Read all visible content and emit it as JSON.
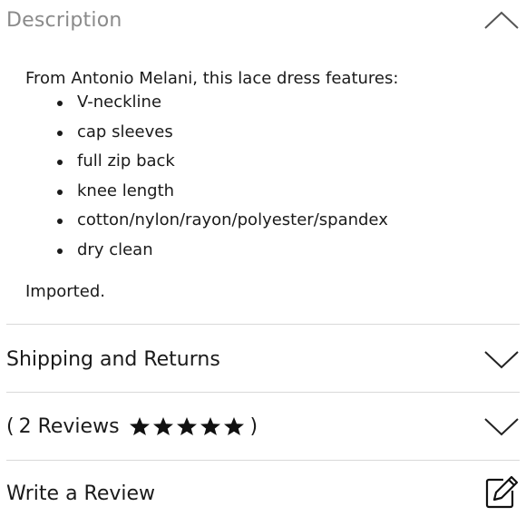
{
  "description": {
    "title": "Description",
    "intro": "From Antonio Melani, this lace dress features:",
    "features": [
      "V-neckline",
      "cap sleeves",
      "full zip back",
      "knee length",
      "cotton/nylon/rayon/polyester/spandex",
      "dry clean"
    ],
    "origin": "Imported.",
    "expanded": true,
    "toggle_icon": "chevron-up-icon"
  },
  "shipping": {
    "title": "Shipping and Returns",
    "toggle_icon": "chevron-down-icon"
  },
  "reviews": {
    "prefix": "(",
    "label": "2 Reviews",
    "suffix": ")",
    "rating": 5,
    "max_rating": 5,
    "toggle_icon": "chevron-down-icon"
  },
  "write_review": {
    "title": "Write a Review",
    "icon": "edit-icon"
  },
  "colors": {
    "header_muted": "#8a8a8a",
    "text": "#1a1a1a",
    "divider": "#d9d9d9"
  }
}
